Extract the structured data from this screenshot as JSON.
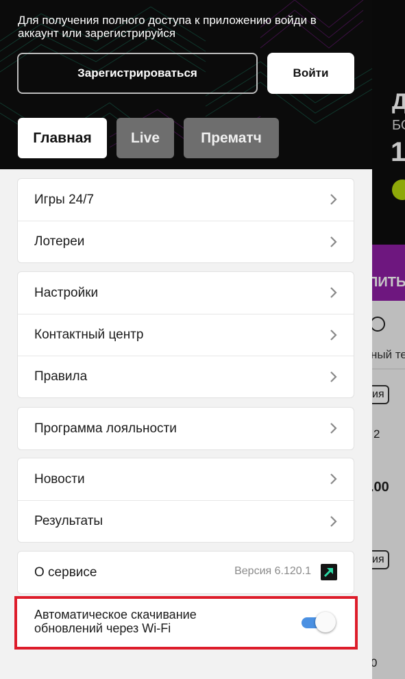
{
  "auth": {
    "message": "Для получения полного доступа к приложению войди в аккаунт или зарегистрируйся",
    "register_label": "Зарегистрироваться",
    "login_label": "Войти"
  },
  "tabs": [
    {
      "label": "Главная",
      "active": true
    },
    {
      "label": "Live",
      "active": false
    },
    {
      "label": "Прематч",
      "active": false
    }
  ],
  "menu_groups": [
    {
      "items": [
        {
          "label": "Игры 24/7"
        },
        {
          "label": "Лотереи"
        }
      ]
    },
    {
      "items": [
        {
          "label": "Настройки"
        },
        {
          "label": "Контактный центр"
        },
        {
          "label": "Правила"
        }
      ]
    },
    {
      "items": [
        {
          "label": "Программа лояльности"
        }
      ]
    },
    {
      "items": [
        {
          "label": "Новости"
        },
        {
          "label": "Результаты"
        }
      ]
    },
    {
      "items": [
        {
          "label": "О сервисе",
          "meta": "Версия 6.120.1"
        }
      ]
    }
  ],
  "wifi_setting": {
    "label": "Автоматическое скачивание обновлений через Wi-Fi",
    "enabled": true,
    "highlight_color": "#dd1c2a",
    "toggle_color": "#4a90e2"
  },
  "background": {
    "banner_line1": "Д",
    "banner_line2": "БОІ",
    "banner_line3": "1",
    "button_fragment": "ПИТЬ",
    "tab_fragment": "ный те",
    "chip1": "ия",
    "num1": "2",
    "odds": ".00",
    "chip2": "ия",
    "num2": "0"
  },
  "colors": {
    "header_bg": "#0b0b0b",
    "accent_green": "#2bd9a5",
    "accent_purple": "#8d1ea3"
  },
  "icons": [
    "search-icon",
    "chevron-right-icon",
    "external-link-icon"
  ]
}
